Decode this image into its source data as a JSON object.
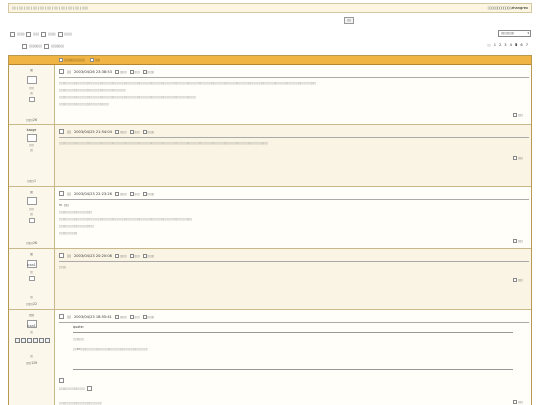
{
  "topbar": {
    "nav_text": "▯▯ | ▯▯ | ▯▯ | ▯▯ | ▯▯ | ▯▯ | ▯▯ | ▯▯ | ▯▯ | ▯▯ | ▯▯▯",
    "user_prefix": "▯▯▯▯▯▯▯▯▯▯▯▯",
    "username": "zhangrex"
  },
  "center_button": "▯▯",
  "toolbar": {
    "new_thread": "▯▯▯▯",
    "new_poll": "▯▯▯",
    "reply": "▯▯▯▯",
    "favorite": "▯▯▯▯",
    "prev_thread": "▯▯▯▯▯▯▯",
    "next_thread": "▯▯▯▯▯▯▯"
  },
  "forum_select": {
    "value": "▯▯▯▯▯▯▯▯"
  },
  "pager": {
    "label": "▯▯",
    "pages": [
      "1",
      "2",
      "3",
      "4",
      "5",
      "6",
      "7"
    ],
    "current": "5"
  },
  "thread": {
    "header_title": "▯▯▯▯▯▯▯▯▯▯▯",
    "header_suffix": "▯▯▯"
  },
  "posts": [
    {
      "author": "▯▯",
      "avatar_caption": "▯▯▯",
      "level": "▯▯",
      "post_count": "▯▯▯▯26",
      "floor_label": "▯▯",
      "timestamp": "2003/04/26 23:38:53",
      "actions": [
        "▯▯▯▯",
        "▯▯▯",
        "▯▯▯▯"
      ],
      "body": [
        "▯▯▯▯▯▯▯▯▯▯▯▯▯▯▯▯▯▯▯▯▯▯▯▯▯▯▯▯▯▯▯▯▯▯▯▯▯▯▯▯▯▯▯▯▯▯▯▯▯▯▯▯▯▯▯▯▯▯▯▯▯▯▯▯▯▯▯▯▯▯▯▯▯▯▯▯▯▯▯▯▯▯▯▯▯▯▯▯▯▯▯▯▯▯▯▯▯▯▯▯▯▯▯▯▯▯▯▯▯▯▯▯▯▯▯▯▯▯▯▯▯▯▯▯▯▯▯▯▯▯▯▯▯▯▯▯▯▯▯",
        "▯▯▯▯▯▯▯▯▯▯▯▯▯▯▯▯▯▯▯▯▯▯▯▯▯▯▯▯▯▯▯▯▯▯▯▯",
        "▯▯▯▯▯▯▯▯▯▯▯▯▯▯▯▯▯▯▯▯▯▯▯▯▯▯▯▯▯▯▯▯▯▯▯▯▯▯▯▯▯▯▯▯▯▯▯▯▯▯▯▯▯▯▯▯▯▯▯▯▯▯▯▯▯▯▯▯▯▯▯▯▯▯",
        "▯▯▯▯▯▯▯▯▯▯▯▯▯▯▯▯▯▯▯▯▯▯▯▯▯▯▯"
      ],
      "reply_label": "▯▯▯"
    },
    {
      "author": "kaoge",
      "avatar_caption": "▯▯▯",
      "level": "▯▯",
      "post_count": "▯▯▯▯1",
      "floor_label": "▯▯",
      "timestamp": "2003/04/25 21:54:04",
      "actions": [
        "▯▯▯▯",
        "▯▯▯",
        "▯▯▯▯"
      ],
      "body": [
        "▯▯▯▯▯▯▯▯▯▯▯▯▯▯▯▯▯▯▯▯▯▯▯▯▯▯▯▯▯▯▯▯▯▯▯▯▯▯▯▯▯▯▯▯▯▯▯▯▯▯▯▯▯▯▯▯▯▯▯▯▯▯▯▯▯▯▯▯▯▯▯▯▯▯▯▯▯▯▯▯▯▯▯▯▯▯▯▯▯▯▯▯▯▯▯▯▯▯▯▯▯▯▯▯▯▯▯▯▯▯▯▯▯"
      ],
      "reply_label": "▯▯▯"
    },
    {
      "author": "▯▯",
      "avatar_caption": "▯▯▯",
      "level": "▯▯",
      "post_count": "▯▯▯▯26",
      "floor_label": "▯▯",
      "timestamp": "2003/04/23 22:23:26",
      "actions": [
        "▯▯▯▯",
        "▯▯▯",
        "▯▯▯▯"
      ],
      "body": [
        "To ▯▯▯",
        "▯▯▯▯▯▯▯▯▯▯▯▯▯▯▯▯▯▯",
        "▯▯▯▯▯▯▯▯▯▯▯▯▯▯▯▯▯▯▯▯▯▯▯▯▯▯▯▯▯▯▯▯▯▯▯▯▯▯▯▯▯▯▯▯▯▯▯▯▯▯▯▯▯▯▯▯▯▯▯▯▯▯▯▯▯▯▯▯▯▯▯▯",
        "▯▯▯▯▯▯▯▯▯▯▯▯▯▯▯▯▯▯▯",
        "▯▯▯▯▯▯▯▯▯▯"
      ],
      "reply_label": "▯▯▯"
    },
    {
      "author": "▯▯",
      "avatar_caption": "icon1",
      "level": "▯▯",
      "post_count": "▯▯▯▯22",
      "floor_label": "▯▯",
      "timestamp": "2003/04/23 20:20:08",
      "actions": [
        "▯▯▯▯",
        "▯▯▯",
        "▯▯▯▯"
      ],
      "body": [
        "▯▯▯▯"
      ],
      "reply_label": "▯▯▯"
    },
    {
      "author": "▯▯▯",
      "avatar_caption": "icon1",
      "level": "▯▯",
      "post_count": "▯▯▯129",
      "floor_label": "▯▯",
      "timestamp": "2003/04/23 18:55:41",
      "actions": [
        "▯▯▯▯",
        "▯▯▯",
        "▯▯▯▯"
      ],
      "quote_label": "quote:",
      "quote_lines": [
        "▯▯▯▯▯▯",
        "▯▯80▯▯▯▯▯▯▯▯▯▯▯▯▯▯▯▯▯▯▯▯▯▯▯▯▯▯▯▯▯▯▯▯▯▯▯▯"
      ],
      "body": [
        "▯▯▯▯▯▯▯▯▯▯▯▯▯▯",
        "▯▯▯▯▯▯▯▯▯▯▯▯▯▯▯▯▯▯▯▯▯▯▯"
      ],
      "reply_label": "▯▯▯"
    }
  ]
}
